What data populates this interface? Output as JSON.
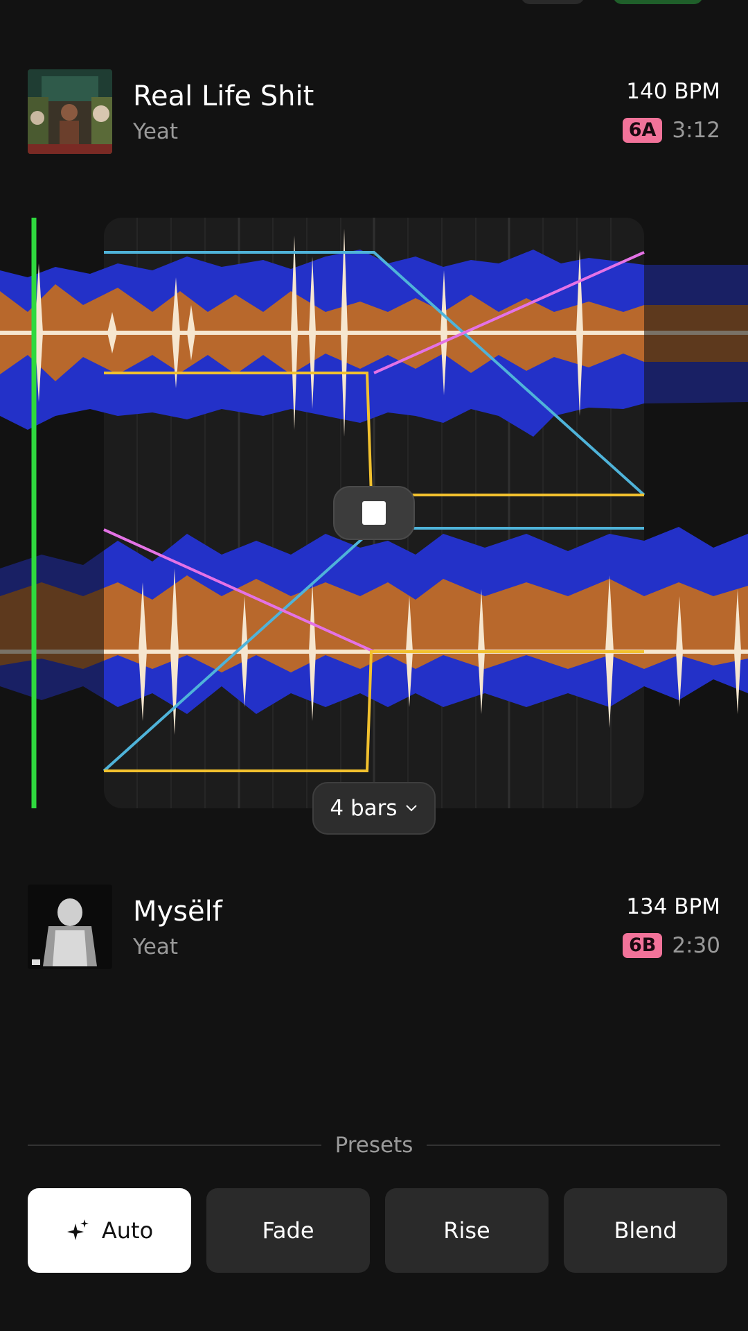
{
  "colors": {
    "background": "#121212",
    "playhead": "#2fd93e",
    "wave_blue": "#2331c8",
    "wave_orange": "#b8682c",
    "wave_cream": "#f6e6cf",
    "line_cyan": "#4fb3d9",
    "line_magenta": "#e472e6",
    "line_yellow": "#f2c12e",
    "key_badge": "#f2739a"
  },
  "track_a": {
    "title": "Real Life Shit",
    "artist": "Yeat",
    "bpm": "140 BPM",
    "key": "6A",
    "duration": "3:12"
  },
  "track_b": {
    "title": "Mysëlf",
    "artist": "Yeat",
    "bpm": "134 BPM",
    "key": "6B",
    "duration": "2:30"
  },
  "transition": {
    "length_label": "4 bars",
    "stop_icon": "stop-icon",
    "dropdown_icon": "chevron-down-icon"
  },
  "presets": {
    "title": "Presets",
    "items": [
      {
        "label": "Auto",
        "icon": "sparkle-icon",
        "active": true
      },
      {
        "label": "Fade",
        "active": false
      },
      {
        "label": "Rise",
        "active": false
      },
      {
        "label": "Blend",
        "active": false
      }
    ]
  }
}
